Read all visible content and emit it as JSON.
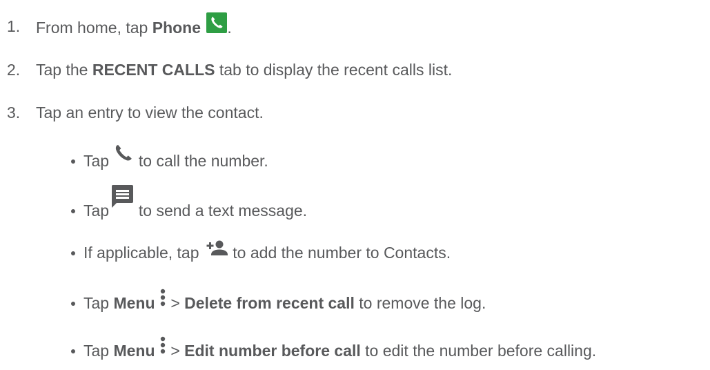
{
  "steps": [
    {
      "number": "1.",
      "pre": "From home, tap ",
      "bold": "Phone",
      "post": ".",
      "icon": "phone-app-icon"
    },
    {
      "number": "2.",
      "pre": "Tap the ",
      "bold": "RECENT CALLS",
      "post": " tab to display the recent calls list."
    },
    {
      "number": "3.",
      "text": "Tap an entry to view the contact."
    }
  ],
  "bullets": [
    {
      "pre": "Tap ",
      "post": " to call the number.",
      "icon": "phone-icon"
    },
    {
      "pre": "Tap ",
      "post": " to send a text message.",
      "icon": "message-icon"
    },
    {
      "pre": "If applicable, tap ",
      "post": " to add the number to Contacts.",
      "icon": "add-contact-icon"
    },
    {
      "pre": "Tap ",
      "bold1": "Menu",
      "sep": " > ",
      "bold2": "Delete from recent call",
      "post": " to remove the log.",
      "icon": "more-vert-icon"
    },
    {
      "pre": "Tap ",
      "bold1": "Menu",
      "sep": " > ",
      "bold2": "Edit number before call",
      "post": " to edit the number before calling.",
      "icon": "more-vert-icon"
    }
  ],
  "colors": {
    "text": "#58595b",
    "phone_app": "#2e9e44",
    "icon": "#58595b"
  }
}
